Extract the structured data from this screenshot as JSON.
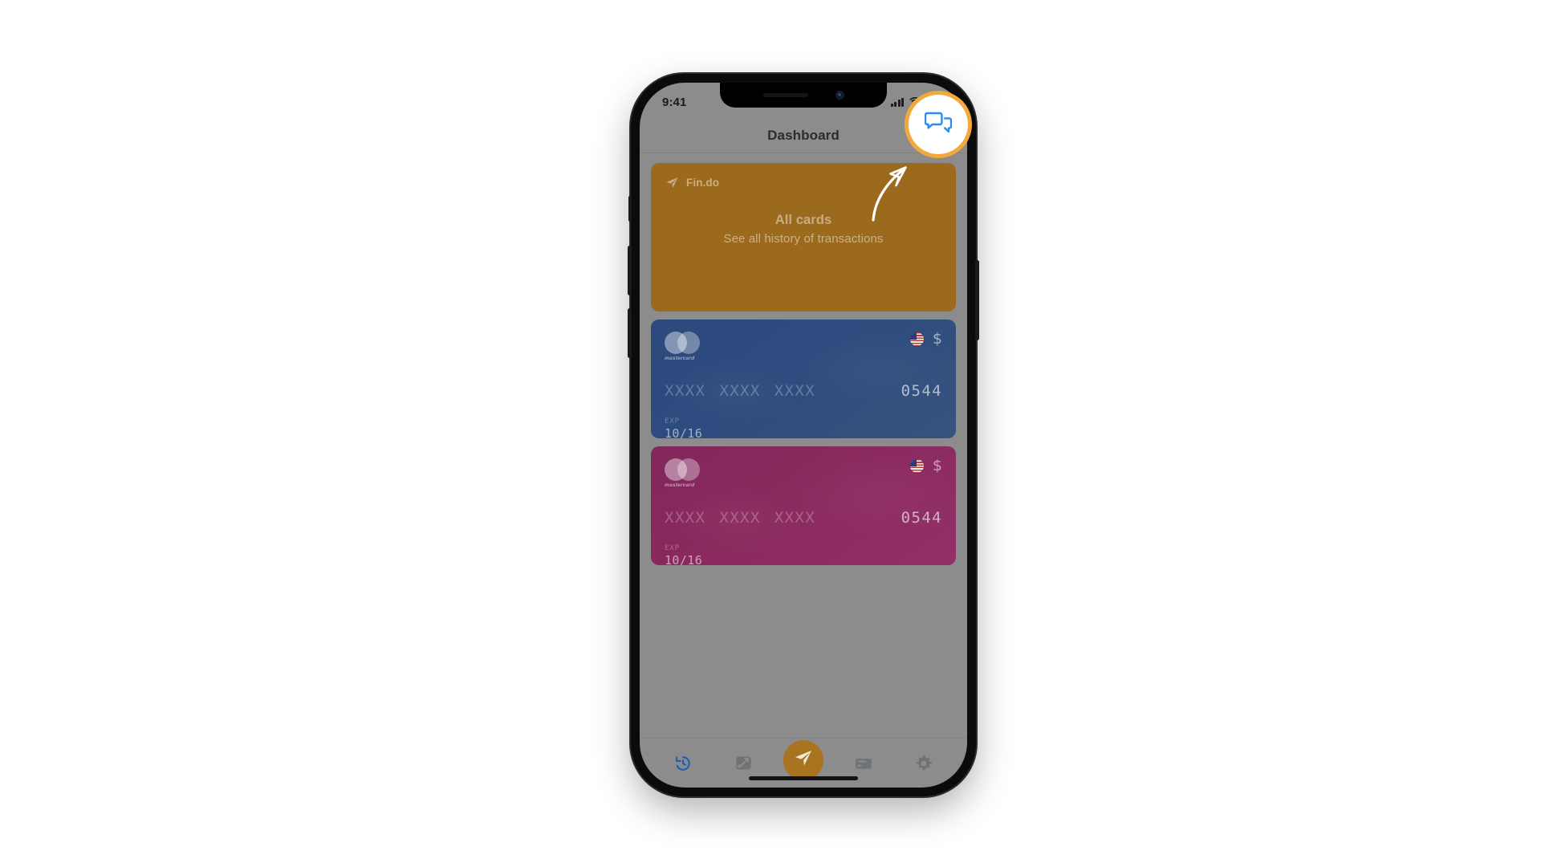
{
  "device": {
    "status_bar": {
      "time": "9:41",
      "signal_icon": "cellular-bars-icon",
      "wifi_icon": "wifi-icon",
      "battery_icon": "battery-icon"
    },
    "home_indicator": "home-indicator"
  },
  "navbar": {
    "title": "Dashboard",
    "action_icon": "chat-bubbles-icon"
  },
  "promo_card": {
    "brand_icon": "paper-plane-icon",
    "brand_name": "Fin.do",
    "title": "All cards",
    "subtitle": "See all history of transactions",
    "background_color": "#9b6a1d"
  },
  "cards": [
    {
      "scheme_logo": "mastercard-logo",
      "scheme_name": "mastercard",
      "flag_icon": "us-flag-icon",
      "currency_symbol": "$",
      "number_groups": [
        "XXXX",
        "XXXX",
        "XXXX"
      ],
      "last_four": "0544",
      "exp_label": "EXP",
      "exp_value": "10/16",
      "theme": "blue",
      "background_color": "#2c4a7d"
    },
    {
      "scheme_logo": "mastercard-logo",
      "scheme_name": "mastercard",
      "flag_icon": "us-flag-icon",
      "currency_symbol": "$",
      "number_groups": [
        "XXXX",
        "XXXX",
        "XXXX"
      ],
      "last_four": "0544",
      "exp_label": "EXP",
      "exp_value": "10/16",
      "theme": "purple",
      "background_color": "#82265c"
    }
  ],
  "tabbar": {
    "items": [
      {
        "icon": "history-clock-icon",
        "active": true,
        "color": "#1a5fb4"
      },
      {
        "icon": "exchange-icon",
        "active": false,
        "color": "#6f7376"
      },
      {
        "icon": "send-paper-plane-icon",
        "active": false,
        "color": "#ffffff",
        "is_primary": true
      },
      {
        "icon": "credit-card-icon",
        "active": false,
        "color": "#6f7376"
      },
      {
        "icon": "gear-icon",
        "active": false,
        "color": "#6f7376"
      }
    ],
    "primary_button_color": "#a9741f"
  },
  "annotation": {
    "highlight_color": "#f2a93b",
    "highlight_target": "chat-bubbles-icon",
    "arrow_icon": "curved-arrow-icon",
    "arrow_color": "#ffffff"
  }
}
